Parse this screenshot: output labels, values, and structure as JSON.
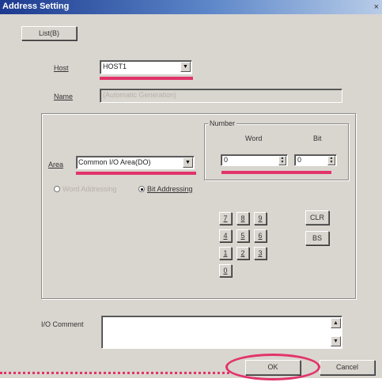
{
  "window": {
    "title": "Address Setting",
    "close_glyph": "×"
  },
  "list_button": "List(B)",
  "host": {
    "label": "Host",
    "value": "HOST1"
  },
  "name": {
    "label": "Name",
    "value": "(Automatic Generation)"
  },
  "number_group": {
    "title": "Number",
    "word_label": "Word",
    "bit_label": "Bit",
    "word_value": "0",
    "bit_value": "0"
  },
  "area": {
    "label": "Area",
    "value": "Common I/O Area(DO)"
  },
  "addressing": {
    "option1": "Word Addressing",
    "option2": "Bit Addressing",
    "selected": "bit"
  },
  "keypad": {
    "keys": [
      "7",
      "8",
      "9",
      "4",
      "5",
      "6",
      "1",
      "2",
      "3",
      "0"
    ],
    "clr": "CLR",
    "bs": "BS"
  },
  "io_comment": {
    "label": "I/O Comment",
    "value": ""
  },
  "buttons": {
    "ok": "OK",
    "cancel": "Cancel"
  },
  "colors": {
    "highlight": "#e2336a",
    "dialog_bg": "#d9d5cf"
  }
}
